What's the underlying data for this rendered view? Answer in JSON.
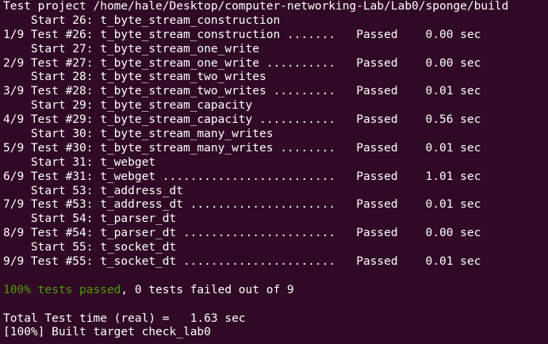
{
  "terminal": {
    "header": "Test project /home/hale/Desktop/computer-networking-Lab/Lab0/sponge/build",
    "entries": [
      {
        "start": "    Start 26: t_byte_stream_construction",
        "result": "1/9 Test #26: t_byte_stream_construction .......   Passed    0.00 sec"
      },
      {
        "start": "    Start 27: t_byte_stream_one_write",
        "result": "2/9 Test #27: t_byte_stream_one_write ..........   Passed    0.00 sec"
      },
      {
        "start": "    Start 28: t_byte_stream_two_writes",
        "result": "3/9 Test #28: t_byte_stream_two_writes .........   Passed    0.01 sec"
      },
      {
        "start": "    Start 29: t_byte_stream_capacity",
        "result": "4/9 Test #29: t_byte_stream_capacity ...........   Passed    0.56 sec"
      },
      {
        "start": "    Start 30: t_byte_stream_many_writes",
        "result": "5/9 Test #30: t_byte_stream_many_writes ........   Passed    0.01 sec"
      },
      {
        "start": "    Start 31: t_webget",
        "result": "6/9 Test #31: t_webget .........................   Passed    1.01 sec"
      },
      {
        "start": "    Start 53: t_address_dt",
        "result": "7/9 Test #53: t_address_dt .....................   Passed    0.01 sec"
      },
      {
        "start": "    Start 54: t_parser_dt",
        "result": "8/9 Test #54: t_parser_dt ......................   Passed    0.00 sec"
      },
      {
        "start": "    Start 55: t_socket_dt",
        "result": "9/9 Test #55: t_socket_dt ......................   Passed    0.01 sec"
      }
    ],
    "summary_green": "100% tests passed",
    "summary_rest": ", 0 tests failed out of 9",
    "total_time": "Total Test time (real) =   1.63 sec",
    "built_target": "[100%] Built target check_lab0"
  },
  "colors": {
    "background": "#300a24",
    "text": "#ffffff",
    "success": "#4e9a06"
  }
}
